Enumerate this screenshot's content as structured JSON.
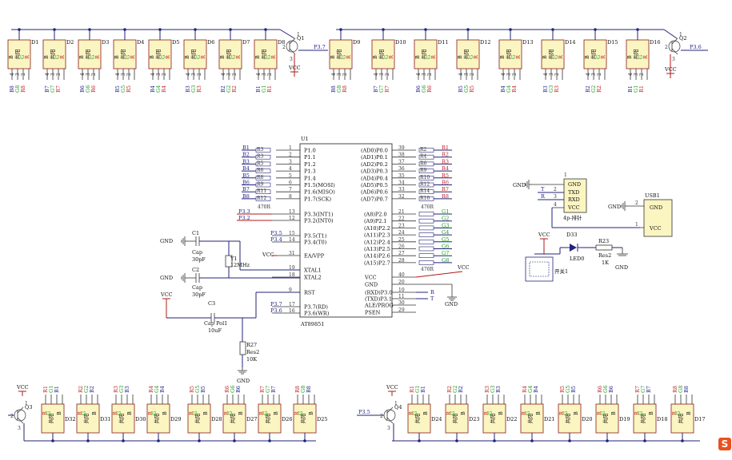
{
  "colors": {
    "wire": "#23237a",
    "power": "#b11a1a",
    "led_fill": "#fbf5c2",
    "net_red": "#c21a1a",
    "net_green": "#17a017",
    "icon_orange": "#e8521e"
  },
  "mcu": {
    "designator": "U1",
    "part": "AT89851",
    "left_pins": [
      {
        "num": "1",
        "name": "P1.0",
        "net": "B1",
        "res": "R3",
        "val": ""
      },
      {
        "num": "2",
        "name": "P1.1",
        "net": "B2",
        "res": "R3",
        "val": ""
      },
      {
        "num": "3",
        "name": "P1.2",
        "net": "B3",
        "res": "R5",
        "val": ""
      },
      {
        "num": "4",
        "name": "P1.3",
        "net": "B4",
        "res": "R6",
        "val": "470R"
      },
      {
        "num": "5",
        "name": "P1.4",
        "net": "B5",
        "res": "R8",
        "val": "470R"
      },
      {
        "num": "6",
        "name": "P1.5(MOSI)",
        "net": "B6",
        "res": "R9",
        "val": "470R"
      },
      {
        "num": "7",
        "name": "P1.6(MISO)",
        "net": "B7",
        "res": "R11",
        "val": "470R"
      },
      {
        "num": "8",
        "name": "P1.7(SCK)",
        "net": "B8",
        "res": "R12",
        "val": "470R"
      }
    ],
    "res_note": "470R",
    "left_pins2": [
      {
        "num": "13",
        "name": "P3.3(INT1)",
        "net": "P3.3"
      },
      {
        "num": "12",
        "name": "P3.2(INT0)",
        "net": "P3.2"
      },
      {
        "num": "15",
        "name": "P3.5(T1)",
        "net": "P3.5"
      },
      {
        "num": "14",
        "name": "P3.4(T0)",
        "net": "P3.4"
      },
      {
        "num": "31",
        "name": "EA/VPP",
        "net": "VCC"
      },
      {
        "num": "19",
        "name": "XTAL1",
        "net": ""
      },
      {
        "num": "18",
        "name": "XTAL2",
        "net": ""
      },
      {
        "num": "9",
        "name": "RST",
        "net": ""
      },
      {
        "num": "17",
        "name": "P3.7(RD)",
        "net": "P3.7"
      },
      {
        "num": "16",
        "name": "P3.6(WR)",
        "net": "P3.6"
      }
    ],
    "right_p0": [
      {
        "num": "39",
        "name": "(AD0)P0.0",
        "res": "R2",
        "net": "R1"
      },
      {
        "num": "38",
        "name": "(AD1)P0.1",
        "res": "R4",
        "net": "R2"
      },
      {
        "num": "37",
        "name": "(AD2)P0.2",
        "res": "R6",
        "net": "R3"
      },
      {
        "num": "36",
        "name": "(AD3)P0.3",
        "res": "R9",
        "net": "R4"
      },
      {
        "num": "35",
        "name": "(AD4)P0.4",
        "res": "R10",
        "net": "R5"
      },
      {
        "num": "34",
        "name": "(AD5)P0.5",
        "res": "R12",
        "net": "R6"
      },
      {
        "num": "33",
        "name": "(AD6)P0.6",
        "res": "R14",
        "net": "R7"
      },
      {
        "num": "32",
        "name": "(AD7)P0.7",
        "res": "R16",
        "net": "R8"
      }
    ],
    "right_p2": [
      {
        "num": "21",
        "name": "(A8)P2.0",
        "net": "G1"
      },
      {
        "num": "22",
        "name": "(A9)P2.1",
        "net": "G2"
      },
      {
        "num": "23",
        "name": "(A10)P2.2",
        "net": "G3"
      },
      {
        "num": "24",
        "name": "(A11)P2.3",
        "net": "G4"
      },
      {
        "num": "25",
        "name": "(A12)P2.4",
        "net": "G5"
      },
      {
        "num": "26",
        "name": "(A13)P2.5",
        "net": "G6"
      },
      {
        "num": "27",
        "name": "(A14)P2.6",
        "net": "G7"
      },
      {
        "num": "28",
        "name": "(A15)P2.7",
        "net": "G8"
      }
    ],
    "p2_res_note": "470R",
    "right_misc": [
      {
        "num": "40",
        "name": "VCC",
        "net": "VCC"
      },
      {
        "num": "20",
        "name": "GND",
        "net": "GND"
      },
      {
        "num": "10",
        "name": "(RXD)P3.0",
        "net": "R"
      },
      {
        "num": "11",
        "name": "(TXD)P3.1",
        "net": "T"
      },
      {
        "num": "30",
        "name": "ALE/PROG",
        "net": ""
      },
      {
        "num": "29",
        "name": "PSEN",
        "net": ""
      }
    ]
  },
  "top_leds_left": {
    "items": [
      {
        "d": "D1",
        "pins": [
          "B8",
          "G8",
          "R8"
        ]
      },
      {
        "d": "D2",
        "pins": [
          "B7",
          "G7",
          "R7"
        ]
      },
      {
        "d": "D3",
        "pins": [
          "B6",
          "G6",
          "R6"
        ]
      },
      {
        "d": "D4",
        "pins": [
          "B5",
          "G5",
          "R5"
        ]
      },
      {
        "d": "D5",
        "pins": [
          "B4",
          "G4",
          "R4"
        ]
      },
      {
        "d": "D6",
        "pins": [
          "B3",
          "G3",
          "R3"
        ]
      },
      {
        "d": "D7",
        "pins": [
          "B2",
          "G2",
          "R2"
        ]
      },
      {
        "d": "D8",
        "pins": [
          "B1",
          "G1",
          "R1"
        ]
      }
    ]
  },
  "top_leds_right": {
    "items": [
      {
        "d": "D9",
        "pins": [
          "B8",
          "G8",
          "R8"
        ]
      },
      {
        "d": "D10",
        "pins": [
          "B7",
          "G7",
          "R7"
        ]
      },
      {
        "d": "D11",
        "pins": [
          "B6",
          "G6",
          "R6"
        ]
      },
      {
        "d": "D12",
        "pins": [
          "B5",
          "G5",
          "R5"
        ]
      },
      {
        "d": "D13",
        "pins": [
          "B4",
          "G4",
          "R4"
        ]
      },
      {
        "d": "D14",
        "pins": [
          "B3",
          "G3",
          "R3"
        ]
      },
      {
        "d": "D15",
        "pins": [
          "B2",
          "G2",
          "R2"
        ]
      },
      {
        "d": "D16",
        "pins": [
          "B1",
          "G1",
          "R1"
        ]
      }
    ]
  },
  "led_text": {
    "common": "共阳",
    "b": "B",
    "g": "G",
    "r": "R",
    "pin4": "4",
    "pin3": "3",
    "pin2": "2",
    "pin1": "1"
  },
  "q1": {
    "des": "Q1",
    "net": "P3.7",
    "vcc": "VCC",
    "p1": "1",
    "p2": "2",
    "p3": "3"
  },
  "q2": {
    "des": "Q2",
    "net": "P3.6",
    "vcc": "VCC",
    "p1": "1",
    "p2": "2",
    "p3": "3"
  },
  "q3": {
    "des": "Q3",
    "vcc": "VCC",
    "p1": "1",
    "p2": "2",
    "p3": "3"
  },
  "q4": {
    "des": "Q4",
    "net": "P3.5",
    "vcc": "VCC",
    "p1": "1",
    "p2": "2",
    "p3": "3"
  },
  "bottom_leds_left": {
    "items": [
      {
        "d": "D32",
        "pins": [
          "R1",
          "G1",
          "B1"
        ]
      },
      {
        "d": "D31",
        "pins": [
          "R2",
          "G2",
          "B2"
        ]
      },
      {
        "d": "D30",
        "pins": [
          "R3",
          "G3",
          "B3"
        ]
      },
      {
        "d": "D29",
        "pins": [
          "R4",
          "G4",
          "B4"
        ]
      },
      {
        "d": "D28",
        "pins": [
          "R5",
          "G5",
          "B5"
        ]
      },
      {
        "d": "D27",
        "pins": [
          "R6",
          "G6",
          "B6"
        ]
      },
      {
        "d": "D26",
        "pins": [
          "R7",
          "G7",
          "B7"
        ]
      },
      {
        "d": "D25",
        "pins": [
          "R8",
          "G8",
          "B8"
        ]
      }
    ]
  },
  "bottom_leds_right": {
    "items": [
      {
        "d": "D24",
        "pins": [
          "R1",
          "G1",
          "B1"
        ]
      },
      {
        "d": "D23",
        "pins": [
          "R2",
          "G2",
          "B2"
        ]
      },
      {
        "d": "D22",
        "pins": [
          "R3",
          "G3",
          "B3"
        ]
      },
      {
        "d": "D21",
        "pins": [
          "R4",
          "G4",
          "B4"
        ]
      },
      {
        "d": "D20",
        "pins": [
          "R5",
          "G5",
          "B5"
        ]
      },
      {
        "d": "D19",
        "pins": [
          "R6",
          "G6",
          "B6"
        ]
      },
      {
        "d": "D18",
        "pins": [
          "R7",
          "G7",
          "B7"
        ]
      },
      {
        "d": "D17",
        "pins": [
          "R8",
          "G8",
          "B8"
        ]
      }
    ]
  },
  "crystal": {
    "c1": "C1",
    "c1v": "Cap",
    "c1n": "30pF",
    "c2": "C2",
    "c2v": "Cap",
    "c2n": "30pF",
    "y1": "Y1",
    "y1v": "12MHz",
    "gnd": "GND"
  },
  "reset": {
    "vcc": "VCC",
    "c3": "C3",
    "c3v": "Cap Pol1",
    "c3n": "10uF",
    "r27": "R27",
    "r27v": "Res2",
    "r27n": "10K",
    "gnd": "GND"
  },
  "uart": {
    "p1": "1",
    "gnd": "GND",
    "txd": "TXD",
    "rxd": "RXD",
    "vcc": "VCC",
    "t": "T",
    "r": "R",
    "n2": "2",
    "n3": "3",
    "n4": "4",
    "label": "4p-排针",
    "gndnet": "GND"
  },
  "usb": {
    "des": "USB1",
    "gnd": "GND",
    "vcc": "VCC",
    "p1": "1",
    "p2": "2",
    "gndnet": "GND"
  },
  "power": {
    "vcc": "VCC",
    "d33": "D33",
    "led": "LED0",
    "r23": "R23",
    "r23v": "Res2",
    "r23n": "1K",
    "sw": "开关1",
    "gnd": "GND"
  },
  "icon": {
    "name": "sogou-s-icon",
    "glyph": "S"
  }
}
